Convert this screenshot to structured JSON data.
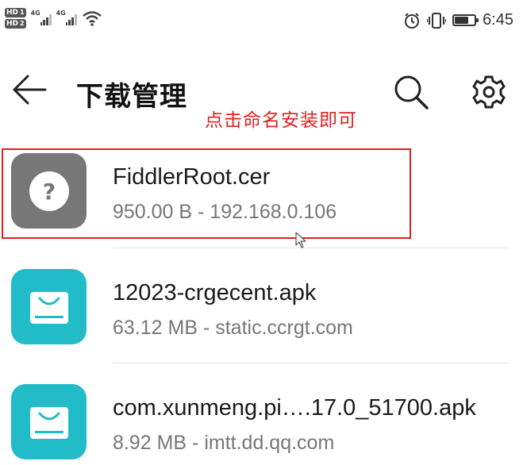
{
  "status_bar": {
    "hd1": "HD",
    "hd1_sub": "1",
    "hd2": "HD",
    "hd2_sub": "2",
    "net1": "4G",
    "net2": "4G",
    "time": "6:45",
    "battery_level": 0.7
  },
  "toolbar": {
    "title": "下载管理"
  },
  "annotation": {
    "text": "点击命名安装即可",
    "color": "#e02020"
  },
  "downloads": [
    {
      "name": "FiddlerRoot.cer",
      "meta": "950.00 B - 192.168.0.106",
      "icon": "unknown-file-icon",
      "icon_color": "#777777"
    },
    {
      "name": "12023-crgecent.apk",
      "meta": "63.12 MB - static.ccrgt.com",
      "icon": "apk-package-icon",
      "icon_color": "#22bcc9"
    },
    {
      "name": "com.xunmeng.pi….17.0_51700.apk",
      "meta": "8.92 MB - imtt.dd.qq.com",
      "icon": "apk-package-icon",
      "icon_color": "#22bcc9"
    }
  ]
}
